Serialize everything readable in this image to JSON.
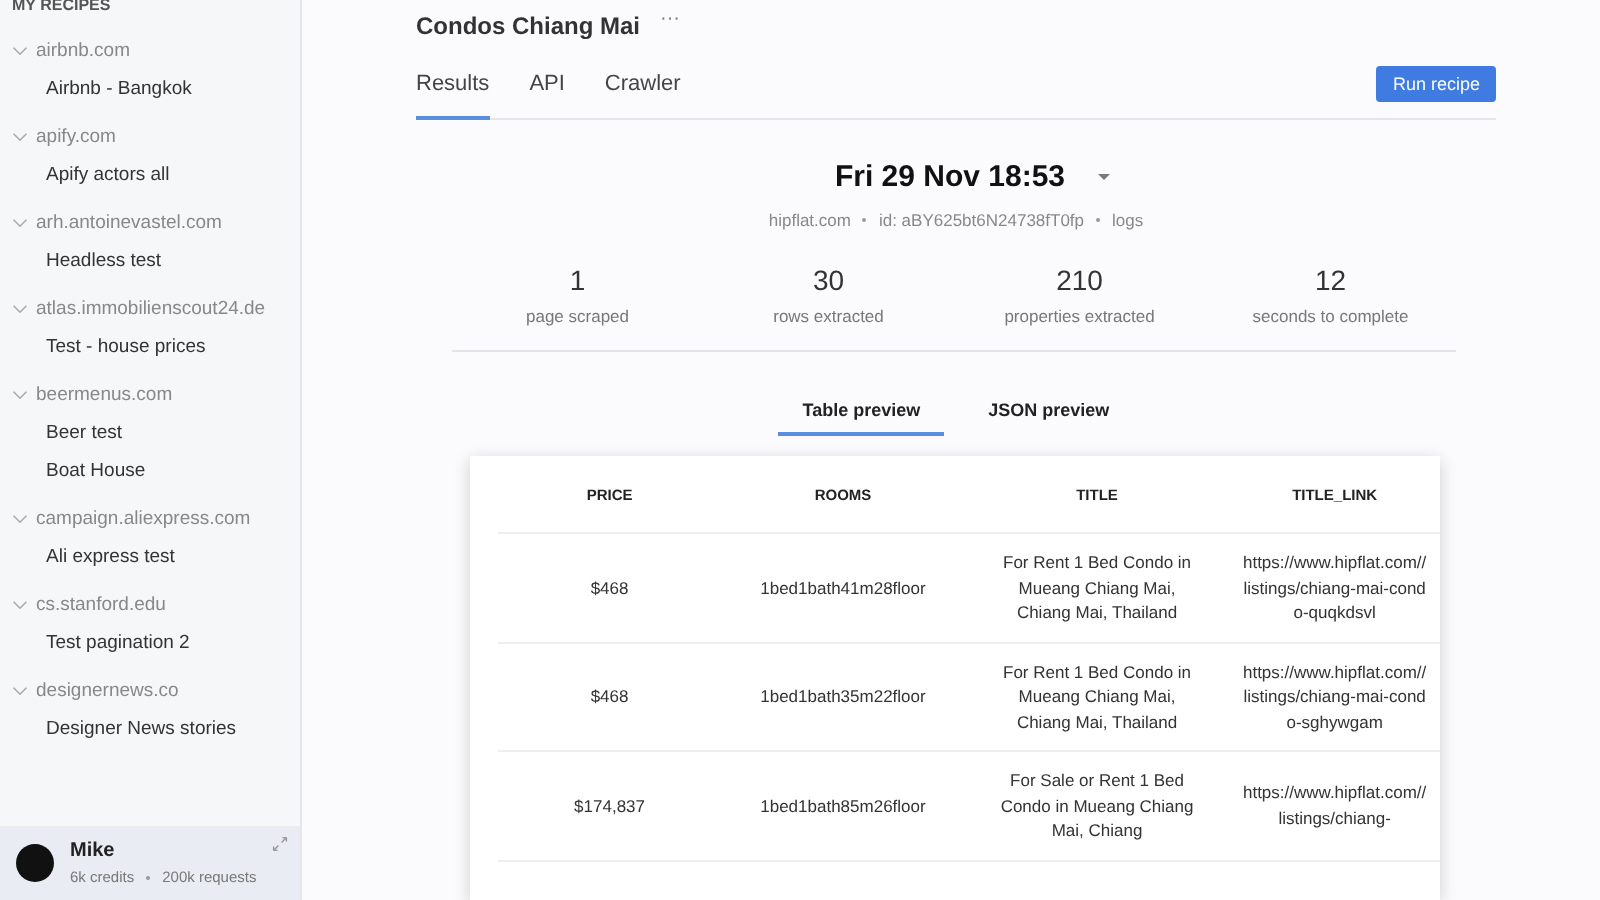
{
  "sidebar": {
    "heading": "MY RECIPES",
    "groups": [
      {
        "domain": "airbnb.com",
        "expanded": true,
        "items": [
          "Airbnb - Bangkok"
        ]
      },
      {
        "domain": "apify.com",
        "expanded": true,
        "items": [
          "Apify actors all"
        ]
      },
      {
        "domain": "arh.antoinevastel.com",
        "expanded": true,
        "items": [
          "Headless test"
        ]
      },
      {
        "domain": "atlas.immobilienscout24.de",
        "expanded": true,
        "items": [
          "Test - house prices"
        ]
      },
      {
        "domain": "beermenus.com",
        "expanded": true,
        "items": [
          "Beer test",
          "Boat House"
        ]
      },
      {
        "domain": "campaign.aliexpress.com",
        "expanded": true,
        "items": [
          "Ali express test"
        ]
      },
      {
        "domain": "cs.stanford.edu",
        "expanded": true,
        "items": [
          "Test pagination 2"
        ]
      },
      {
        "domain": "designernews.co",
        "expanded": true,
        "items": [
          "Designer News stories"
        ]
      }
    ],
    "user": {
      "name": "Mike",
      "credits": "6k credits",
      "requests": "200k requests"
    }
  },
  "recipe": {
    "title": "Condos Chiang Mai",
    "more": "···"
  },
  "tabs": [
    {
      "label": "Results",
      "selected": true
    },
    {
      "label": "API",
      "selected": false
    },
    {
      "label": "Crawler",
      "selected": false
    }
  ],
  "run_button": "Run recipe",
  "run": {
    "date": "Fri 29 Nov 18:53",
    "site": "hipflat.com",
    "id": "id: aBY625bt6N24738fT0fp",
    "logs": "logs"
  },
  "stats": [
    {
      "value": "1",
      "label": "page scraped"
    },
    {
      "value": "30",
      "label": "rows extracted"
    },
    {
      "value": "210",
      "label": "properties extracted"
    },
    {
      "value": "12",
      "label": "seconds to complete"
    }
  ],
  "preview_tabs": [
    {
      "label": "Table preview",
      "selected": true
    },
    {
      "label": "JSON preview",
      "selected": false
    }
  ],
  "table": {
    "columns": [
      "PRICE",
      "ROOMS",
      "TITLE",
      "TITLE_LINK"
    ],
    "rows": [
      [
        "$468",
        "1bed1bath41m28floor",
        "For Rent 1 Bed Condo in Mueang Chiang Mai, Chiang Mai, Thailand",
        "https://www.hipflat.com//listings/chiang-mai-condo-quqkdsvl"
      ],
      [
        "$468",
        "1bed1bath35m22floor",
        "For Rent 1 Bed Condo in Mueang Chiang Mai, Chiang Mai, Thailand",
        "https://www.hipflat.com//listings/chiang-mai-condo-sghywgam"
      ],
      [
        "$174,837",
        "1bed1bath85m26floor",
        "For Sale or Rent 1 Bed Condo in Mueang Chiang Mai, Chiang",
        "https://www.hipflat.com//listings/chiang-"
      ]
    ]
  }
}
